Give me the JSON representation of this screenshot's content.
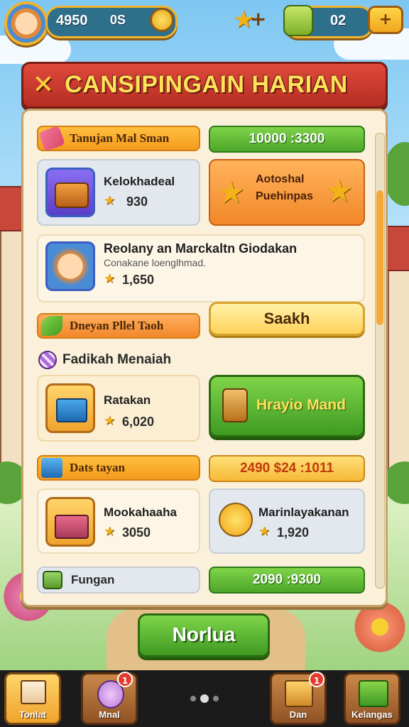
{
  "top_bar": {
    "coins": "4950",
    "coin_sub": "0S",
    "gems": "02",
    "plus": "+"
  },
  "banner": {
    "title": "CANSIPINGAIN HARIAN",
    "close": "✕"
  },
  "rows": {
    "r1_header": "Tanujan Mal Sman",
    "r1_bar": "10000 :3300",
    "card1_title": "Kelokhadeal",
    "card1_value": "930",
    "card2_title_a": "Aotoshal",
    "card2_title_b": "Puehinpas",
    "card3_title": "Reolany an Marckaltn Giodakan",
    "card3_sub": "Conakane loenglhmad.",
    "card3_value": "1,650",
    "r2_header": "Dneyan Pllel Taoh",
    "r2_button": "Saakh",
    "r3_header": "Fadikah Menaiah",
    "card4_title": "Ratakan",
    "card4_value": "6,020",
    "card5_button": "Hrayio Mand",
    "r4_header": "Dats tayan",
    "r4_bar": "2490 $24 :1011",
    "card6_title": "Mookahaaha",
    "card6_value": "3050",
    "card7_title": "Marinlayakanan",
    "card7_value": "1,920",
    "r5_header": "Fungan",
    "r5_bar": "2090 :9300"
  },
  "main_button": "Norlua",
  "bottom_nav": [
    {
      "label": "Tonlat",
      "badge": ""
    },
    {
      "label": "Mnal",
      "badge": "1"
    },
    {
      "label": "Dan",
      "badge": "1"
    },
    {
      "label": "Kelangas",
      "badge": ""
    }
  ],
  "colors": {
    "accent_red": "#c8372b",
    "accent_green": "#4ea62a",
    "accent_orange": "#f49b1c"
  }
}
